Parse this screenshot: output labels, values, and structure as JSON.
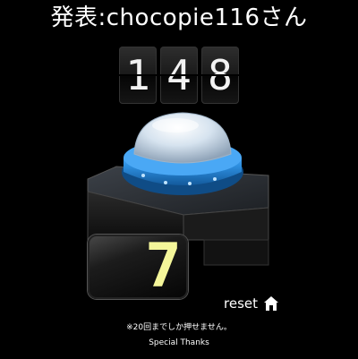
{
  "header": {
    "title": "発表:chocopie116さん"
  },
  "counter": {
    "digits": [
      "1",
      "4",
      "8"
    ]
  },
  "press_button": {
    "color": "#2e8fe0"
  },
  "display": {
    "value": "7",
    "color": "#f4f69a"
  },
  "reset": {
    "label": "reset",
    "icon": "home-icon"
  },
  "footer": {
    "notice": "※20回までしか押せません。",
    "thanks": "Special Thanks"
  }
}
